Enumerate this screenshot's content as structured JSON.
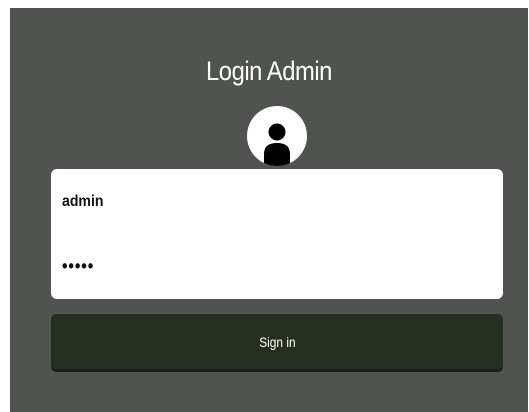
{
  "login": {
    "title": "Login Admin",
    "username_value": "admin",
    "password_value": "•••••",
    "signin_label": "Sign in",
    "avatar_icon": "user-icon"
  },
  "colors": {
    "panel_background": "#515350",
    "button_background": "#262e22",
    "card_background": "#ffffff",
    "text_light": "#ffffff"
  }
}
